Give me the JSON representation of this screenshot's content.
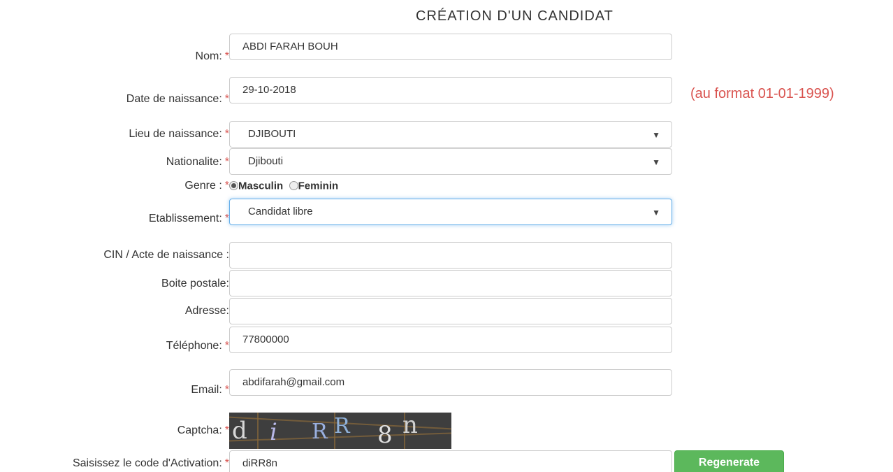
{
  "title": "CRÉATION D'UN CANDIDAT",
  "required_mark": "*",
  "hint_date": "(au format 01-01-1999)",
  "fields": {
    "nom": {
      "label": "Nom:",
      "value": "ABDI FARAH BOUH"
    },
    "date": {
      "label": "Date de naissance:",
      "value": "29-10-2018"
    },
    "lieu": {
      "label": "Lieu de naissance:",
      "value": "DJIBOUTI"
    },
    "nationalite": {
      "label": "Nationalite:",
      "value": "Djibouti"
    },
    "etablissement": {
      "label": "Etablissement:",
      "value": "Candidat libre"
    },
    "cin": {
      "label": "CIN / Acte de naissance :",
      "value": ""
    },
    "boite": {
      "label": "Boite postale:",
      "value": ""
    },
    "adresse": {
      "label": "Adresse:",
      "value": ""
    },
    "telephone": {
      "label": "Téléphone:",
      "value": "77800000"
    },
    "email": {
      "label": "Email:",
      "value": "abdifarah@gmail.com"
    },
    "code": {
      "label": "Saisissez le code d'Activation:",
      "value": "diRR8n"
    }
  },
  "genre": {
    "label": "Genre :",
    "options": [
      "Masculin",
      "Feminin"
    ],
    "selected": "Masculin"
  },
  "captcha": {
    "label": "Captcha:",
    "chars": [
      "d",
      "i",
      "R",
      "R",
      "8",
      "n"
    ],
    "colors": [
      "#d8d8d8",
      "#b8b8e8",
      "#9ab0e0",
      "#8fb0d8",
      "#e0e0e0",
      "#d0d0d0"
    ]
  },
  "buttons": {
    "regenerate": "Regenerate"
  },
  "colors": {
    "required": "#d9534f",
    "regenerate_bg": "#5cb85c",
    "focus": "#66afe9"
  }
}
